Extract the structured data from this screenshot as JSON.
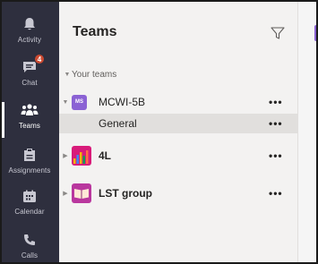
{
  "rail": {
    "items": [
      {
        "id": "activity",
        "label": "Activity",
        "icon": "bell-icon",
        "active": false
      },
      {
        "id": "chat",
        "label": "Chat",
        "icon": "chat-icon",
        "active": false,
        "badge": "4"
      },
      {
        "id": "teams",
        "label": "Teams",
        "icon": "teams-icon",
        "active": true
      },
      {
        "id": "assignments",
        "label": "Assignments",
        "icon": "assignments-icon",
        "active": false
      },
      {
        "id": "calendar",
        "label": "Calendar",
        "icon": "calendar-icon",
        "active": false
      },
      {
        "id": "calls",
        "label": "Calls",
        "icon": "phone-icon",
        "active": false
      }
    ]
  },
  "panel": {
    "title": "Teams",
    "section_label": "Your teams",
    "teams": [
      {
        "name": "MCWI-5B",
        "avatar_text": "MS",
        "expanded": true,
        "bold": false,
        "channels": [
          {
            "name": "General",
            "selected": true
          }
        ]
      },
      {
        "name": "4L",
        "expanded": false,
        "bold": true
      },
      {
        "name": "LST group",
        "expanded": false,
        "bold": true
      }
    ],
    "more_label": "•••"
  },
  "colors": {
    "rail_bg": "#2e2f3e",
    "accent": "#8b62d4",
    "badge": "#cc4a31",
    "selected_row": "#e1dfdd"
  }
}
